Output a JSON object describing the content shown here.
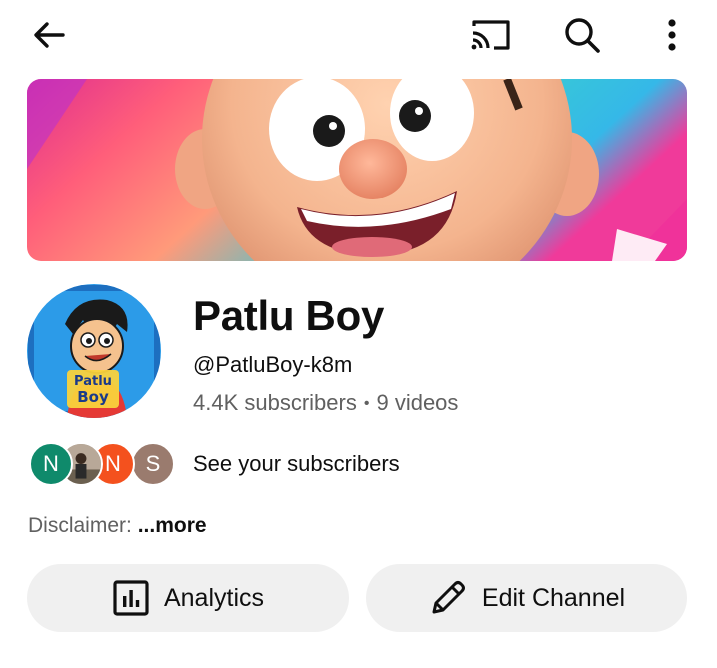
{
  "topbar": {
    "back_icon": "arrow-left-icon",
    "cast_icon": "cast-icon",
    "search_icon": "search-icon",
    "more_icon": "more-vertical-icon"
  },
  "channel": {
    "name": "Patlu Boy",
    "handle": "@PatluBoy-k8m",
    "subscribers": "4.4K subscribers",
    "separator": "•",
    "videos": "9 videos",
    "avatar_text_line1": "Patlu",
    "avatar_text_line2": "Boy"
  },
  "subscribers_row": {
    "avatars": [
      {
        "letter": "N",
        "color": "#0f8a6b"
      },
      {
        "letter": "",
        "color": "#8a7a6a"
      },
      {
        "letter": "N",
        "color": "#f4511e"
      },
      {
        "letter": "S",
        "color": "#9a7b6e"
      }
    ],
    "label": "See your subscribers"
  },
  "description": {
    "prefix": "Disclaimer: ",
    "more": "...more"
  },
  "actions": {
    "analytics_label": "Analytics",
    "analytics_icon": "analytics-icon",
    "edit_label": "Edit Channel",
    "edit_icon": "pencil-icon"
  }
}
